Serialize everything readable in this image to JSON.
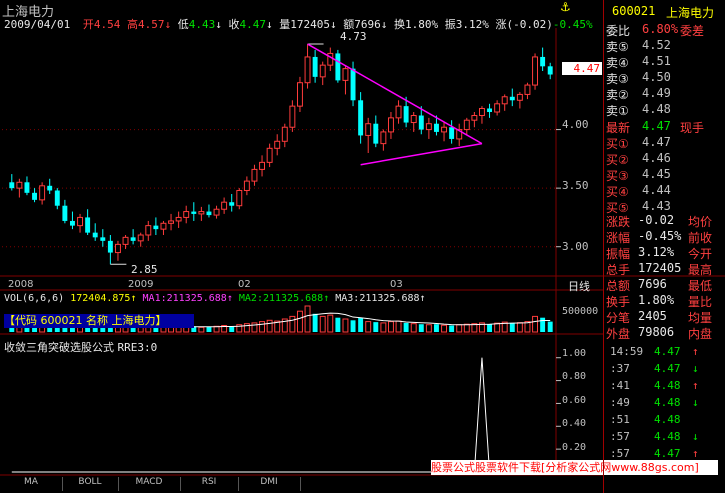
{
  "header": {
    "title": "上海电力",
    "date": "2009/04/01",
    "open_label": "开",
    "open": "4.54",
    "high_label": "高",
    "high": "4.57",
    "low_label": "低",
    "low": "4.43",
    "close_label": "收",
    "close": "4.47",
    "vol_label": "量",
    "vol": "172405",
    "amount_label": "额",
    "amount": "7696",
    "turnover_label": "换",
    "turnover": "1.80%",
    "amplitude_label": "振",
    "amplitude": "3.12%",
    "change_label": "涨",
    "change": "(-0.02)",
    "change_pct": "-0.45%"
  },
  "price_axis": [
    "4.00",
    "3.50",
    "3.00"
  ],
  "current_price_tag": "4.47",
  "annotations": {
    "high_mark": "4.73",
    "low_mark": "2.85"
  },
  "time_axis": {
    "labels": [
      "2008",
      "2009",
      "02",
      "03"
    ],
    "right_label": "日线"
  },
  "vol_header": {
    "name": "VOL(6,6,6)",
    "vol": "172404.875",
    "ma1": "MA1:211325.688",
    "ma2": "MA2:211325.688",
    "ma3": "MA3:211325.688",
    "scale": "500000"
  },
  "code_bar": "【代码 600021 名称 上海电力】",
  "indicator": {
    "name": "收敛三角突破选股公式",
    "value": "RRE3:0",
    "axis": [
      "1.00",
      "0.80",
      "0.60",
      "0.40",
      "0.20"
    ]
  },
  "tabs": [
    "MA",
    "BOLL",
    "MACD",
    "RSI",
    "DMI"
  ],
  "watermark": "股票公式股票软件下载[分析家公式网www.88gs.com]",
  "side_panel": {
    "code": "600021",
    "name": "上海电力",
    "webi_label": "委比",
    "webi": "6.80%",
    "weicha_label": "委差",
    "asks": [
      {
        "label": "卖⑤",
        "price": "4.52"
      },
      {
        "label": "卖④",
        "price": "4.51"
      },
      {
        "label": "卖③",
        "price": "4.50"
      },
      {
        "label": "卖②",
        "price": "4.49"
      },
      {
        "label": "卖①",
        "price": "4.48"
      }
    ],
    "latest_label": "最新",
    "latest": "4.47",
    "hand_label": "现手",
    "bids": [
      {
        "label": "买①",
        "price": "4.47"
      },
      {
        "label": "买②",
        "price": "4.46"
      },
      {
        "label": "买③",
        "price": "4.45"
      },
      {
        "label": "买④",
        "price": "4.44"
      },
      {
        "label": "买⑤",
        "price": "4.43"
      }
    ],
    "stats": [
      {
        "l1": "涨跌",
        "v1": "-0.02",
        "l2": "均价"
      },
      {
        "l1": "涨幅",
        "v1": "-0.45%",
        "l2": "前收"
      },
      {
        "l1": "振幅",
        "v1": "3.12%",
        "l2": "今开"
      },
      {
        "l1": "总手",
        "v1": "172405",
        "l2": "最高"
      },
      {
        "l1": "总额",
        "v1": "7696",
        "l2": "最低"
      },
      {
        "l1": "换手",
        "v1": "1.80%",
        "l2": "量比"
      },
      {
        "l1": "分笔",
        "v1": "2405",
        "l2": "均量"
      },
      {
        "l1": "外盘",
        "v1": "79806",
        "l2": "内盘"
      }
    ],
    "ticks": [
      {
        "time": "14:59",
        "price": "4.47",
        "dir": "↑"
      },
      {
        "time": ":37",
        "price": "4.47",
        "dir": "↓"
      },
      {
        "time": ":41",
        "price": "4.48",
        "dir": "↑"
      },
      {
        "time": ":49",
        "price": "4.48",
        "dir": "↓"
      },
      {
        "time": ":51",
        "price": "4.48",
        "dir": ""
      },
      {
        "time": ":57",
        "price": "4.48",
        "dir": "↓"
      },
      {
        "time": ":57",
        "price": "4.47",
        "dir": "↑"
      }
    ]
  },
  "colors": {
    "up": "#ff3c3c",
    "down": "#00ffff",
    "triangle": "#ff00ff",
    "ma": "#ffffff",
    "grid": "#800000"
  },
  "chart_data": {
    "type": "candlestick",
    "title": "上海电力",
    "ylim": [
      2.75,
      4.85
    ],
    "indicator_ylim": [
      0,
      1.05
    ],
    "candles": [
      [
        3.55,
        3.62,
        3.48,
        3.5
      ],
      [
        3.5,
        3.58,
        3.42,
        3.55
      ],
      [
        3.55,
        3.6,
        3.44,
        3.46
      ],
      [
        3.46,
        3.5,
        3.38,
        3.4
      ],
      [
        3.4,
        3.55,
        3.36,
        3.52
      ],
      [
        3.52,
        3.58,
        3.45,
        3.48
      ],
      [
        3.48,
        3.5,
        3.32,
        3.35
      ],
      [
        3.35,
        3.4,
        3.2,
        3.22
      ],
      [
        3.22,
        3.3,
        3.15,
        3.18
      ],
      [
        3.18,
        3.28,
        3.12,
        3.25
      ],
      [
        3.25,
        3.32,
        3.1,
        3.12
      ],
      [
        3.12,
        3.2,
        3.05,
        3.08
      ],
      [
        3.08,
        3.15,
        3.0,
        3.05
      ],
      [
        3.05,
        3.1,
        2.85,
        2.95
      ],
      [
        2.95,
        3.05,
        2.88,
        3.02
      ],
      [
        3.02,
        3.1,
        2.98,
        3.08
      ],
      [
        3.08,
        3.15,
        3.02,
        3.05
      ],
      [
        3.05,
        3.12,
        3.0,
        3.1
      ],
      [
        3.1,
        3.22,
        3.05,
        3.18
      ],
      [
        3.18,
        3.25,
        3.1,
        3.15
      ],
      [
        3.15,
        3.22,
        3.1,
        3.2
      ],
      [
        3.2,
        3.28,
        3.14,
        3.22
      ],
      [
        3.22,
        3.3,
        3.16,
        3.25
      ],
      [
        3.25,
        3.35,
        3.2,
        3.3
      ],
      [
        3.3,
        3.38,
        3.22,
        3.28
      ],
      [
        3.28,
        3.34,
        3.22,
        3.3
      ],
      [
        3.3,
        3.36,
        3.25,
        3.27
      ],
      [
        3.27,
        3.35,
        3.24,
        3.32
      ],
      [
        3.32,
        3.42,
        3.28,
        3.38
      ],
      [
        3.38,
        3.45,
        3.3,
        3.35
      ],
      [
        3.35,
        3.5,
        3.32,
        3.48
      ],
      [
        3.48,
        3.6,
        3.44,
        3.56
      ],
      [
        3.56,
        3.7,
        3.52,
        3.66
      ],
      [
        3.66,
        3.78,
        3.6,
        3.72
      ],
      [
        3.72,
        3.88,
        3.68,
        3.84
      ],
      [
        3.84,
        3.96,
        3.78,
        3.9
      ],
      [
        3.9,
        4.05,
        3.85,
        4.02
      ],
      [
        4.02,
        4.25,
        3.98,
        4.2
      ],
      [
        4.2,
        4.45,
        4.15,
        4.4
      ],
      [
        4.4,
        4.73,
        4.35,
        4.62
      ],
      [
        4.62,
        4.68,
        4.4,
        4.45
      ],
      [
        4.45,
        4.58,
        4.38,
        4.55
      ],
      [
        4.55,
        4.7,
        4.5,
        4.65
      ],
      [
        4.65,
        4.68,
        4.4,
        4.42
      ],
      [
        4.42,
        4.55,
        4.3,
        4.52
      ],
      [
        4.52,
        4.58,
        4.2,
        4.25
      ],
      [
        4.25,
        4.32,
        3.88,
        3.95
      ],
      [
        3.95,
        4.1,
        3.8,
        4.05
      ],
      [
        4.05,
        4.12,
        3.85,
        3.88
      ],
      [
        3.88,
        4.0,
        3.82,
        3.98
      ],
      [
        3.98,
        4.15,
        3.92,
        4.1
      ],
      [
        4.1,
        4.25,
        4.05,
        4.2
      ],
      [
        4.2,
        4.28,
        4.02,
        4.06
      ],
      [
        4.06,
        4.15,
        3.98,
        4.12
      ],
      [
        4.12,
        4.2,
        3.96,
        4.0
      ],
      [
        4.0,
        4.1,
        3.92,
        4.05
      ],
      [
        4.05,
        4.12,
        3.95,
        3.98
      ],
      [
        3.98,
        4.06,
        3.9,
        4.02
      ],
      [
        4.02,
        4.08,
        3.88,
        3.92
      ],
      [
        3.92,
        4.05,
        3.86,
        4.0
      ],
      [
        4.0,
        4.1,
        3.95,
        4.08
      ],
      [
        4.08,
        4.15,
        4.02,
        4.12
      ],
      [
        4.12,
        4.2,
        4.05,
        4.18
      ],
      [
        4.18,
        4.22,
        4.1,
        4.15
      ],
      [
        4.15,
        4.25,
        4.12,
        4.22
      ],
      [
        4.22,
        4.3,
        4.16,
        4.28
      ],
      [
        4.28,
        4.35,
        4.2,
        4.25
      ],
      [
        4.25,
        4.32,
        4.18,
        4.3
      ],
      [
        4.3,
        4.4,
        4.26,
        4.38
      ],
      [
        4.38,
        4.65,
        4.34,
        4.62
      ],
      [
        4.62,
        4.7,
        4.5,
        4.54
      ],
      [
        4.54,
        4.57,
        4.43,
        4.47
      ]
    ],
    "volumes": [
      0.3,
      0.25,
      0.22,
      0.2,
      0.28,
      0.22,
      0.2,
      0.25,
      0.22,
      0.2,
      0.18,
      0.2,
      0.22,
      0.3,
      0.25,
      0.2,
      0.18,
      0.2,
      0.22,
      0.18,
      0.2,
      0.22,
      0.18,
      0.2,
      0.22,
      0.18,
      0.2,
      0.22,
      0.25,
      0.2,
      0.28,
      0.32,
      0.35,
      0.4,
      0.45,
      0.42,
      0.5,
      0.6,
      0.8,
      1.0,
      0.7,
      0.6,
      0.65,
      0.55,
      0.5,
      0.45,
      0.55,
      0.4,
      0.38,
      0.35,
      0.4,
      0.42,
      0.35,
      0.32,
      0.3,
      0.28,
      0.3,
      0.26,
      0.25,
      0.28,
      0.3,
      0.32,
      0.35,
      0.3,
      0.34,
      0.38,
      0.35,
      0.36,
      0.4,
      0.6,
      0.55,
      0.4
    ],
    "indicator": [
      0,
      0,
      0,
      0,
      0,
      0,
      0,
      0,
      0,
      0,
      0,
      0,
      0,
      0,
      0,
      0,
      0,
      0,
      0,
      0,
      0,
      0,
      0,
      0,
      0,
      0,
      0,
      0,
      0,
      0,
      0,
      0,
      0,
      0,
      0,
      0,
      0,
      0,
      0,
      0,
      0,
      0,
      0,
      0,
      0,
      0,
      0,
      0,
      0,
      0,
      0,
      0,
      0,
      0,
      0,
      0,
      0,
      0,
      0,
      0,
      0,
      0,
      1,
      0,
      0,
      0,
      0,
      0,
      0,
      0,
      0,
      0
    ],
    "triangle": {
      "upper": [
        [
          39,
          4.73
        ],
        [
          62,
          3.88
        ]
      ],
      "lower": [
        [
          46,
          3.7
        ],
        [
          62,
          3.88
        ]
      ]
    }
  }
}
